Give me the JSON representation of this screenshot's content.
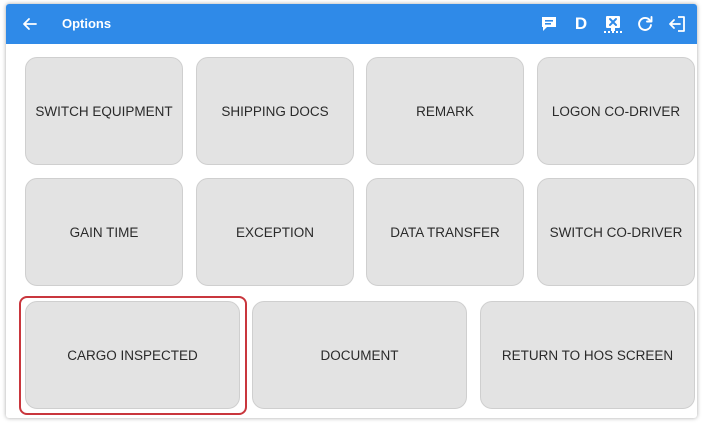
{
  "appbar": {
    "title": "Options",
    "background": "#2f8ae8",
    "back_icon": "arrow-left-icon",
    "actions": [
      {
        "name": "message-icon",
        "kind": "icon"
      },
      {
        "name": "status-d",
        "kind": "text",
        "label": "D"
      },
      {
        "name": "sync-icon",
        "kind": "icon"
      },
      {
        "name": "refresh-icon",
        "kind": "icon"
      },
      {
        "name": "logout-icon",
        "kind": "icon"
      }
    ]
  },
  "buttons": [
    {
      "id": "switch-equipment",
      "label": "SWITCH EQUIPMENT"
    },
    {
      "id": "shipping-docs",
      "label": "SHIPPING DOCS"
    },
    {
      "id": "remark",
      "label": "REMARK"
    },
    {
      "id": "logon-co-driver",
      "label": "LOGON CO-DRIVER"
    },
    {
      "id": "gain-time",
      "label": "GAIN TIME"
    },
    {
      "id": "exception",
      "label": "EXCEPTION"
    },
    {
      "id": "data-transfer",
      "label": "DATA TRANSFER"
    },
    {
      "id": "switch-co-driver",
      "label": "SWITCH CO-DRIVER"
    },
    {
      "id": "cargo-inspected",
      "label": "CARGO INSPECTED"
    },
    {
      "id": "document",
      "label": "DOCUMENT"
    },
    {
      "id": "return-to-hos-screen",
      "label": "RETURN TO HOS SCREEN"
    }
  ],
  "highlighted_button": "cargo-inspected",
  "highlight_color": "#c9363d"
}
